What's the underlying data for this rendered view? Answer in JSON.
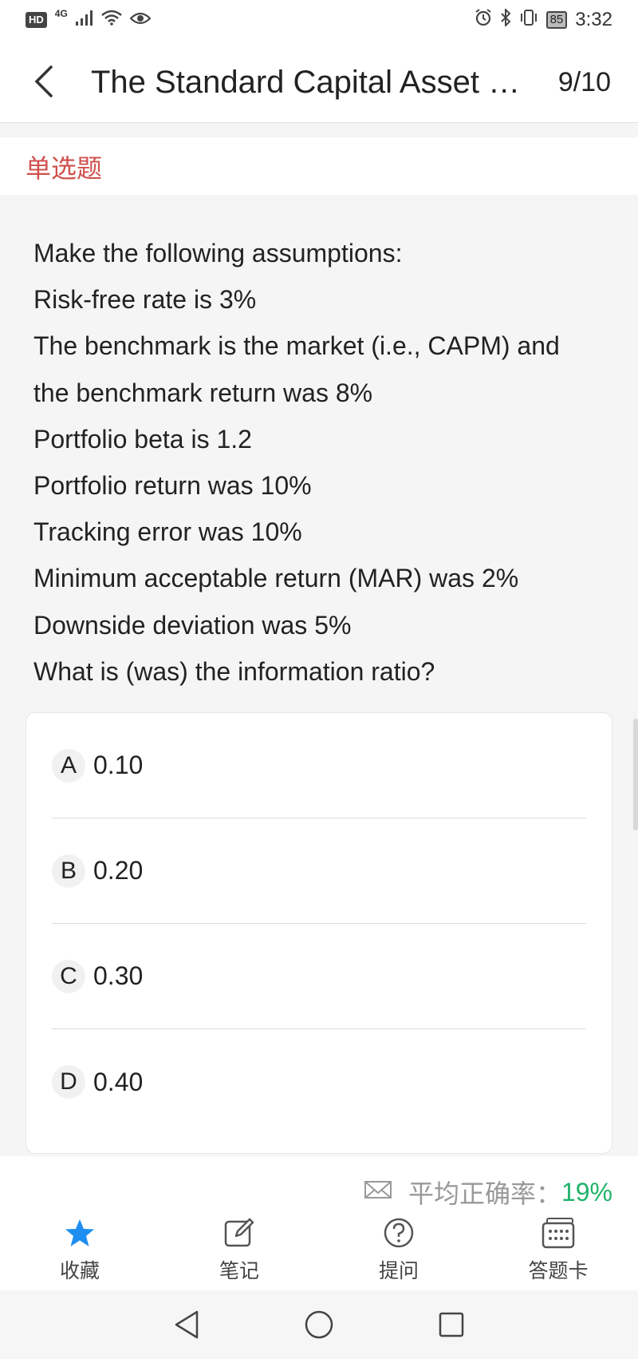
{
  "status_bar": {
    "hd": "HD",
    "network": "4G",
    "battery": "85",
    "time": "3:32"
  },
  "header": {
    "title": "The Standard Capital Asset Pr...",
    "counter": "9/10"
  },
  "question": {
    "type_label": "单选题",
    "lines": [
      "Make the following assumptions:",
      "Risk-free rate is 3%",
      "The benchmark is the market (i.e., CAPM) and",
      "the benchmark return was 8%",
      "Portfolio beta is 1.2",
      "Portfolio return was 10%",
      "Tracking error was 10%",
      "Minimum acceptable return (MAR) was 2%",
      "Downside deviation was 5%",
      "What is (was) the information ratio?"
    ]
  },
  "options": [
    {
      "letter": "A",
      "text": "0.10"
    },
    {
      "letter": "B",
      "text": "0.20"
    },
    {
      "letter": "C",
      "text": "0.30"
    },
    {
      "letter": "D",
      "text": "0.40"
    }
  ],
  "stats": {
    "label": "平均正确率：",
    "value": "19%"
  },
  "toolbar": [
    {
      "label": "收藏",
      "icon": "star-icon"
    },
    {
      "label": "笔记",
      "icon": "note-edit-icon"
    },
    {
      "label": "提问",
      "icon": "question-icon"
    },
    {
      "label": "答题卡",
      "icon": "answer-card-icon"
    }
  ],
  "colors": {
    "type_label": "#d0504d",
    "accuracy": "#1fb36b",
    "star": "#1e8ef0"
  }
}
